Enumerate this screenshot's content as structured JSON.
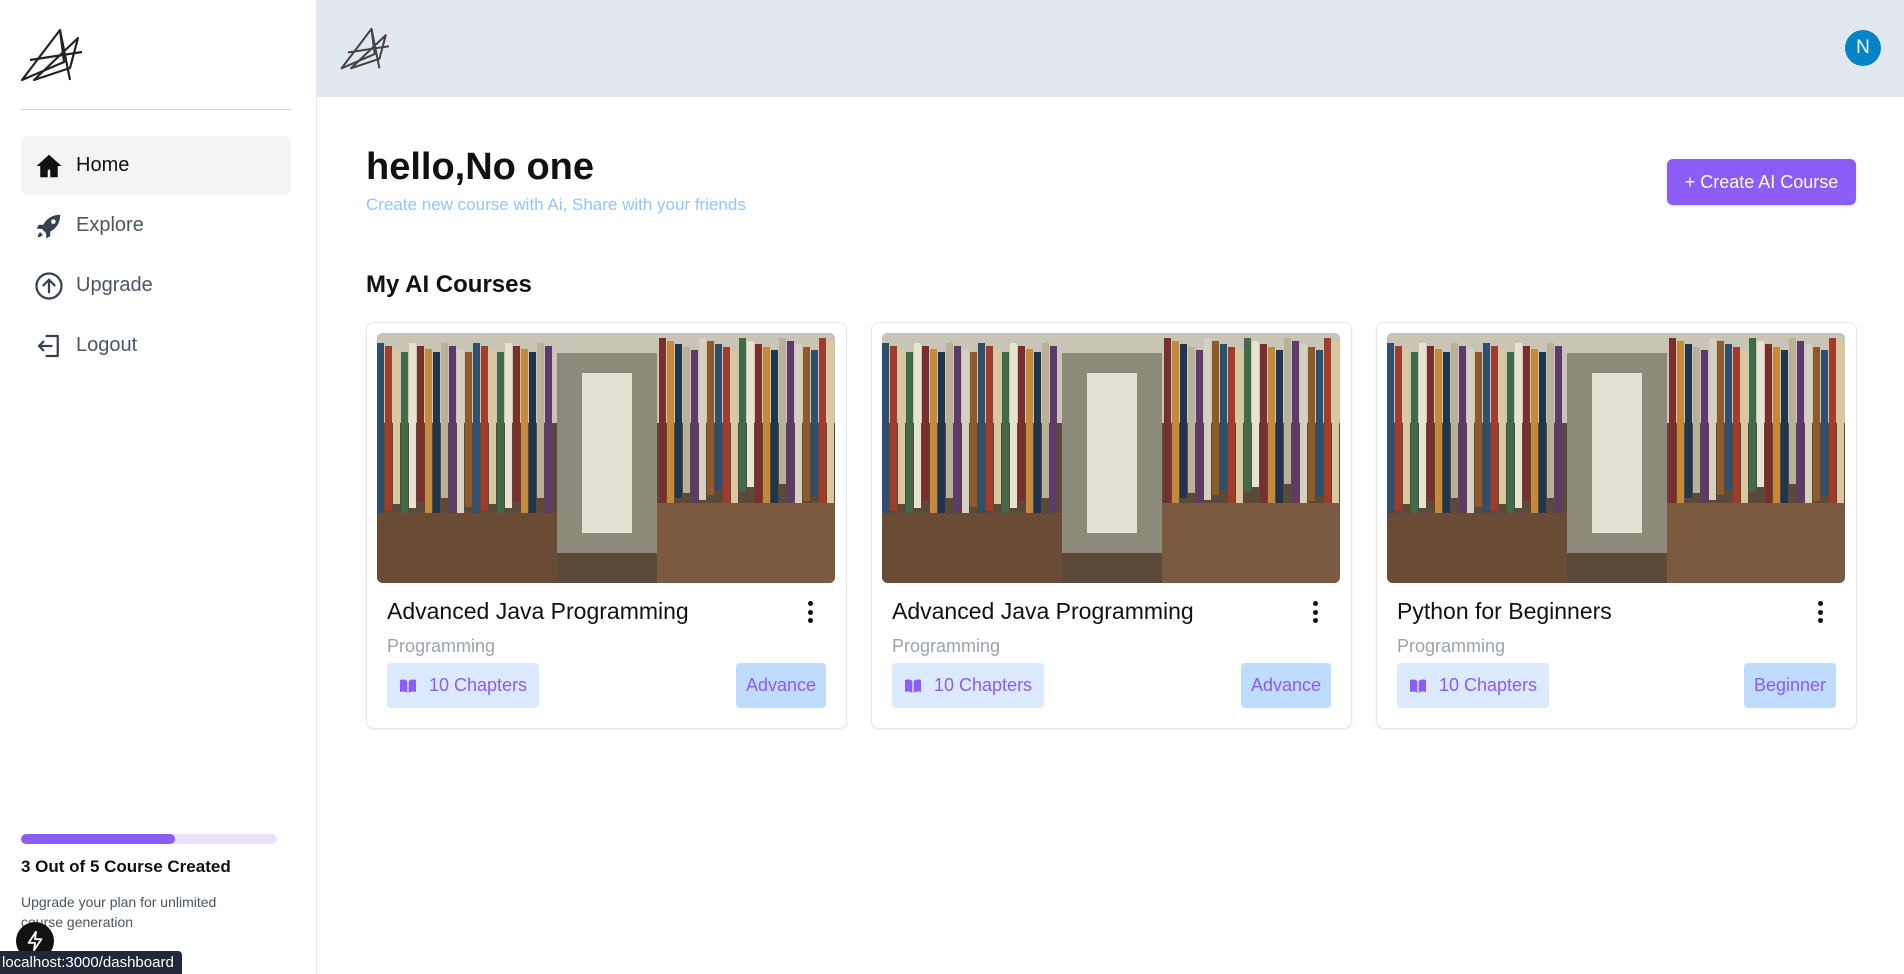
{
  "sidebar": {
    "items": [
      {
        "label": "Home",
        "icon": "home-icon",
        "active": true
      },
      {
        "label": "Explore",
        "icon": "rocket-icon",
        "active": false
      },
      {
        "label": "Upgrade",
        "icon": "arrow-up-circle-icon",
        "active": false
      },
      {
        "label": "Logout",
        "icon": "logout-icon",
        "active": false
      }
    ],
    "usage": {
      "progress_fraction": 0.6,
      "title": "3 Out of 5 Course Created",
      "subtitle": "Upgrade your plan for unlimited course generation"
    },
    "status_url": "localhost:3000/dashboard"
  },
  "header": {
    "avatar_initial": "N"
  },
  "main": {
    "greeting_prefix": "hello,",
    "greeting_name": "No one",
    "subtitle": "Create new course with Ai, Share with your friends",
    "create_button": "+ Create AI Course",
    "section_title": "My AI Courses",
    "courses": [
      {
        "title": "Advanced Java Programming",
        "category": "Programming",
        "chapters": "10 Chapters",
        "level": "Advance"
      },
      {
        "title": "Advanced Java Programming",
        "category": "Programming",
        "chapters": "10 Chapters",
        "level": "Advance"
      },
      {
        "title": "Python for Beginners",
        "category": "Programming",
        "chapters": "10 Chapters",
        "level": "Beginner"
      }
    ]
  },
  "colors": {
    "accent": "#8b5cf6",
    "header_bg": "#e2e8f0",
    "subtitle": "#93c5fd",
    "avatar": "#0284c7",
    "badge_bg": "#dbeafe"
  }
}
